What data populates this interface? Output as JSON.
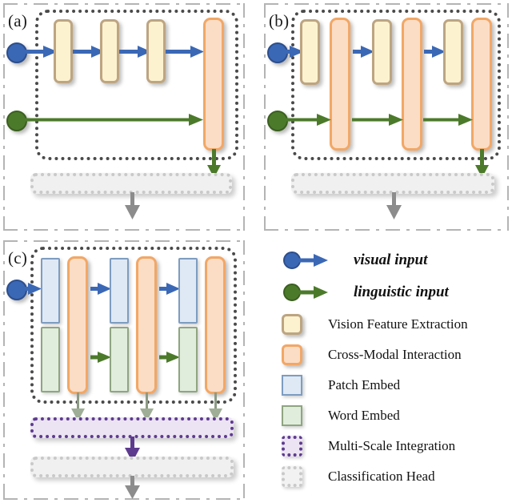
{
  "figure": {
    "type": "architecture-diagram",
    "panels": [
      {
        "id": "a",
        "label": "(a)",
        "description": "Late fusion: visual stream passes through three Vision Feature Extraction blocks then a single Cross-Modal Interaction block; linguistic input enters the Cross-Modal Interaction block directly.",
        "vision_blocks": 3,
        "cross_modal_blocks": 1,
        "has_multi_scale_integration": false,
        "has_classification_head": true
      },
      {
        "id": "b",
        "label": "(b)",
        "description": "Interleaved fusion: three Vision Feature Extraction blocks alternate with three Cross-Modal Interaction blocks; the linguistic stream is injected at every Cross-Modal Interaction block.",
        "vision_blocks": 3,
        "cross_modal_blocks": 3,
        "has_multi_scale_integration": false,
        "has_classification_head": true
      },
      {
        "id": "c",
        "label": "(c)",
        "description": "Proposed multi-scale design: three Patch Embed and three Word Embed stages alternate with three Cross-Modal Interaction blocks, each feeding a Multi-Scale Integration bar before the Classification Head.",
        "patch_embed_blocks": 3,
        "word_embed_blocks": 3,
        "cross_modal_blocks": 3,
        "has_multi_scale_integration": true,
        "has_classification_head": true
      }
    ]
  },
  "legend": {
    "items": [
      {
        "key": "visual-input",
        "icon": "blue-circle-arrow",
        "label": "visual input",
        "style": "emphasis",
        "color": "#3b68b5"
      },
      {
        "key": "linguistic-input",
        "icon": "green-circle-arrow",
        "label": "linguistic input",
        "style": "emphasis",
        "color": "#4c7a2b"
      },
      {
        "key": "vision-feature-extraction",
        "icon": "yellow-swatch",
        "label": "Vision Feature Extraction",
        "style": "plain",
        "color": "#fdf2cf"
      },
      {
        "key": "cross-modal-interaction",
        "icon": "orange-swatch",
        "label": "Cross-Modal Interaction",
        "style": "plain",
        "color": "#fbddc6"
      },
      {
        "key": "patch-embed",
        "icon": "blue-swatch",
        "label": "Patch Embed",
        "style": "plain",
        "color": "#dfe9f5"
      },
      {
        "key": "word-embed",
        "icon": "green-swatch",
        "label": "Word Embed",
        "style": "plain",
        "color": "#e0eddc"
      },
      {
        "key": "multi-scale-integration",
        "icon": "purple-dotted-swatch",
        "label": "Multi-Scale Integration",
        "style": "plain",
        "color": "#ece4f3"
      },
      {
        "key": "classification-head",
        "icon": "gray-dotted-swatch",
        "label": "Classification Head",
        "style": "plain",
        "color": "#f2f2f2"
      }
    ]
  },
  "colors": {
    "visual_arrow": "#3b68b5",
    "linguistic_arrow": "#4c7a2b",
    "multi_scale_arrow": "#8c9b84",
    "integration_arrow": "#5e3b8f",
    "output_arrow": "#8c8c8c",
    "vision_fill": "#fdf2cf",
    "vision_stroke": "#bda582",
    "cross_modal_fill": "#fbddc6",
    "cross_modal_stroke": "#f2a766",
    "patch_fill": "#dfe9f5",
    "patch_stroke": "#7e9cc0",
    "word_fill": "#e0eddc",
    "word_stroke": "#8fa581",
    "group_border": "#4a4a4a",
    "panel_border": "#b4b4b4"
  }
}
